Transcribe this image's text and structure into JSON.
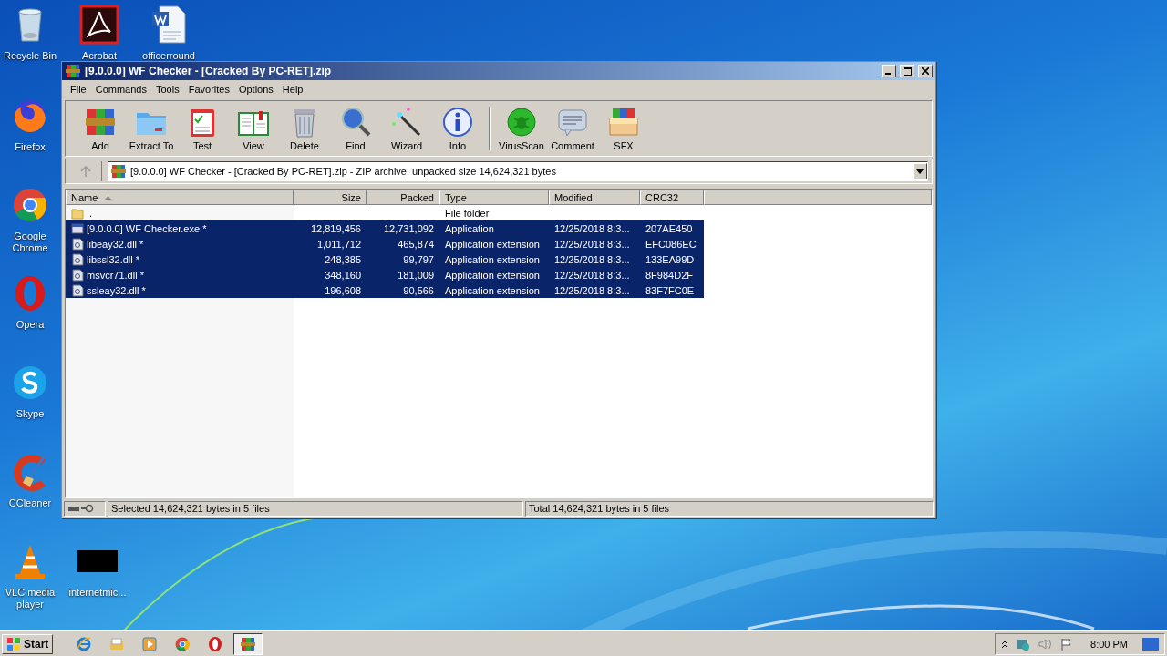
{
  "desktop_icons": [
    {
      "label": "Recycle Bin",
      "kind": "recycle"
    },
    {
      "label": "Acrobat",
      "kind": "acrobat"
    },
    {
      "label": "officerround",
      "kind": "word"
    },
    {
      "label": "Firefox",
      "kind": "firefox"
    },
    {
      "label": "Google Chrome",
      "kind": "chrome"
    },
    {
      "label": "Opera",
      "kind": "opera"
    },
    {
      "label": "Skype",
      "kind": "skype"
    },
    {
      "label": "CCleaner",
      "kind": "ccleaner"
    },
    {
      "label": "VLC media player",
      "kind": "vlc"
    },
    {
      "label": "internetmic...",
      "kind": "blank"
    }
  ],
  "window": {
    "title": "[9.0.0.0] WF Checker - [Cracked By PC-RET].zip",
    "menu": [
      "File",
      "Commands",
      "Tools",
      "Favorites",
      "Options",
      "Help"
    ],
    "toolbar": [
      {
        "label": "Add",
        "kind": "add"
      },
      {
        "label": "Extract To",
        "kind": "extract"
      },
      {
        "label": "Test",
        "kind": "test"
      },
      {
        "label": "View",
        "kind": "view"
      },
      {
        "label": "Delete",
        "kind": "delete"
      },
      {
        "label": "Find",
        "kind": "find"
      },
      {
        "label": "Wizard",
        "kind": "wizard"
      },
      {
        "label": "Info",
        "kind": "info"
      },
      {
        "label": "VirusScan",
        "kind": "virus"
      },
      {
        "label": "Comment",
        "kind": "comment"
      },
      {
        "label": "SFX",
        "kind": "sfx"
      }
    ],
    "address": "[9.0.0.0] WF Checker - [Cracked By PC-RET].zip - ZIP archive, unpacked size 14,624,321 bytes",
    "columns": [
      {
        "label": "Name",
        "sorted": true
      },
      {
        "label": "Size",
        "sorted": false
      },
      {
        "label": "Packed",
        "sorted": false
      },
      {
        "label": "Type",
        "sorted": false
      },
      {
        "label": "Modified",
        "sorted": false
      },
      {
        "label": "CRC32",
        "sorted": false
      }
    ],
    "rows": [
      {
        "kind": "folder",
        "name": "..",
        "type": "File folder",
        "selected": false
      },
      {
        "kind": "exe",
        "name": "[9.0.0.0] WF Checker.exe *",
        "size": "12,819,456",
        "packed": "12,731,092",
        "type": "Application",
        "modified": "12/25/2018 8:3...",
        "crc": "207AE450",
        "selected": true
      },
      {
        "kind": "dll",
        "name": "libeay32.dll *",
        "size": "1,011,712",
        "packed": "465,874",
        "type": "Application extension",
        "modified": "12/25/2018 8:3...",
        "crc": "EFC086EC",
        "selected": true
      },
      {
        "kind": "dll",
        "name": "libssl32.dll *",
        "size": "248,385",
        "packed": "99,797",
        "type": "Application extension",
        "modified": "12/25/2018 8:3...",
        "crc": "133EA99D",
        "selected": true
      },
      {
        "kind": "dll",
        "name": "msvcr71.dll *",
        "size": "348,160",
        "packed": "181,009",
        "type": "Application extension",
        "modified": "12/25/2018 8:3...",
        "crc": "8F984D2F",
        "selected": true
      },
      {
        "kind": "dll",
        "name": "ssleay32.dll *",
        "size": "196,608",
        "packed": "90,566",
        "type": "Application extension",
        "modified": "12/25/2018 8:3...",
        "crc": "83F7FC0E",
        "selected": true
      }
    ],
    "status": {
      "selected": "Selected 14,624,321 bytes in 5 files",
      "total": "Total 14,624,321 bytes in 5 files"
    }
  },
  "taskbar": {
    "start": "Start",
    "apps": [
      {
        "kind": "ie",
        "active": false
      },
      {
        "kind": "explorer",
        "active": false
      },
      {
        "kind": "media",
        "active": false
      },
      {
        "kind": "chrome",
        "active": false
      },
      {
        "kind": "opera",
        "active": false
      },
      {
        "kind": "winrar",
        "active": true
      }
    ],
    "time": "8:00 PM"
  }
}
